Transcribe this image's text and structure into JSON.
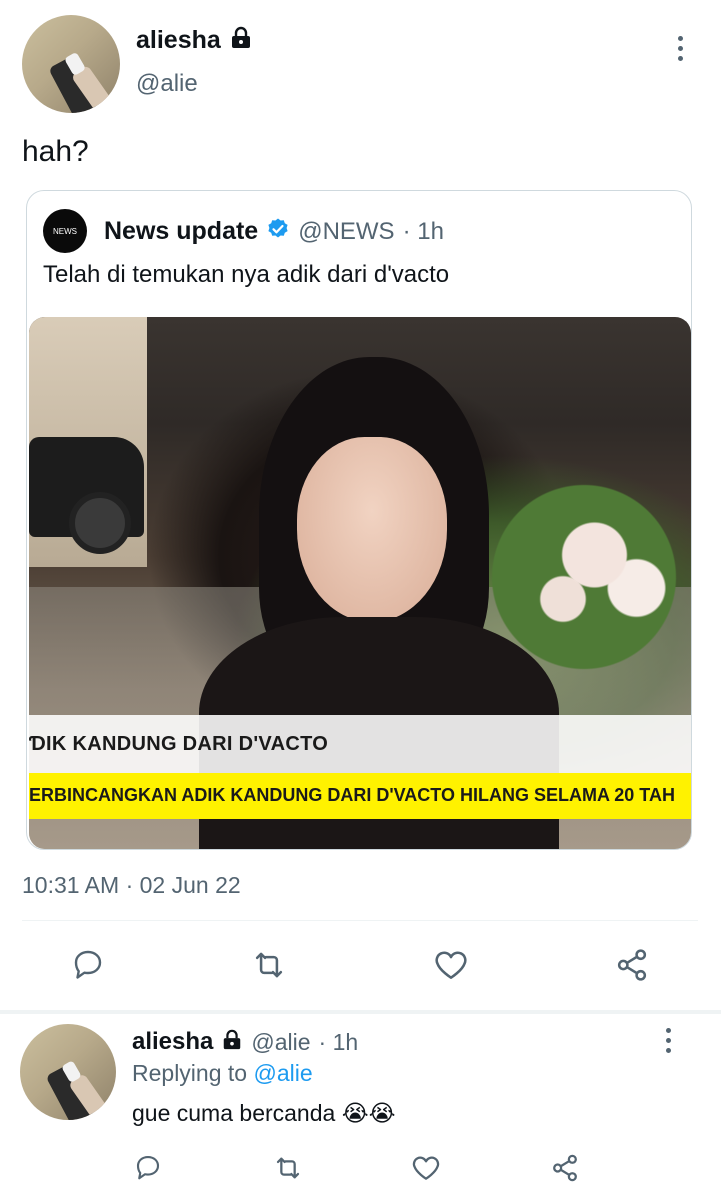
{
  "main_tweet": {
    "display_name": "aliesha",
    "handle": "@alie",
    "text": "hah?",
    "timestamp": "10:31 AM · 02 Jun 22",
    "locked": true
  },
  "quoted_tweet": {
    "logo_text": "NEWS",
    "display_name": "News update",
    "verified": true,
    "handle": "@NEWS",
    "age": "· 1h",
    "text": "Telah di temukan nya adik dari d'vacto",
    "image": {
      "caption_white": "ƊIK KANDUNG DARI D'VACTO",
      "caption_yellow": "ERBINCANGKAN ADIK KANDUNG DARI D'VACTO HILANG SELAMA 20 TAH"
    }
  },
  "actions": [
    "reply-icon",
    "retweet-icon",
    "like-icon",
    "share-icon"
  ],
  "reply_tweet": {
    "display_name": "aliesha",
    "handle": "@alie",
    "age": "· 1h",
    "replying_prefix": "Replying to",
    "replying_to": "@alie",
    "text": "gue cuma bercanda 😭😭",
    "locked": true
  },
  "colors": {
    "accent": "#1d9bf0",
    "muted": "#536471",
    "border": "#cfd9de",
    "caption_yellow": "#fff200"
  }
}
